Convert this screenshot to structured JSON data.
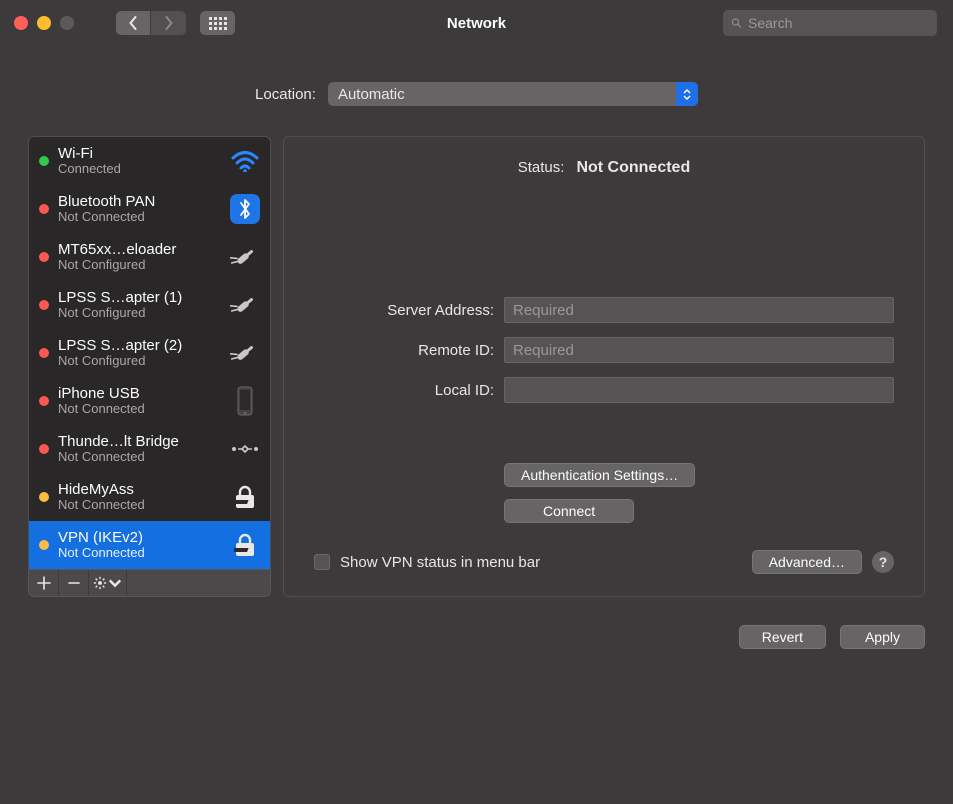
{
  "window": {
    "title": "Network",
    "search_placeholder": "Search"
  },
  "location": {
    "label": "Location:",
    "value": "Automatic"
  },
  "services": [
    {
      "name": "Wi-Fi",
      "status": "Connected",
      "dot": "green",
      "icon": "wifi",
      "selected": false
    },
    {
      "name": "Bluetooth PAN",
      "status": "Not Connected",
      "dot": "red",
      "icon": "bluetooth",
      "selected": false
    },
    {
      "name": "MT65xx…eloader",
      "status": "Not Configured",
      "dot": "red",
      "icon": "modem",
      "selected": false
    },
    {
      "name": "LPSS S…apter (1)",
      "status": "Not Configured",
      "dot": "red",
      "icon": "modem",
      "selected": false
    },
    {
      "name": "LPSS S…apter (2)",
      "status": "Not Configured",
      "dot": "red",
      "icon": "modem",
      "selected": false
    },
    {
      "name": "iPhone USB",
      "status": "Not Connected",
      "dot": "red",
      "icon": "iphone",
      "selected": false
    },
    {
      "name": "Thunde…lt Bridge",
      "status": "Not Connected",
      "dot": "red",
      "icon": "bridge",
      "selected": false
    },
    {
      "name": "HideMyAss",
      "status": "Not Connected",
      "dot": "yellow",
      "icon": "vpn",
      "selected": false
    },
    {
      "name": "VPN (IKEv2)",
      "status": "Not Connected",
      "dot": "yellow",
      "icon": "vpn",
      "selected": true
    }
  ],
  "detail": {
    "status_label": "Status:",
    "status_value": "Not Connected",
    "server_label": "Server Address:",
    "server_placeholder": "Required",
    "remote_label": "Remote ID:",
    "remote_placeholder": "Required",
    "local_label": "Local ID:",
    "auth_btn": "Authentication Settings…",
    "connect_btn": "Connect",
    "show_vpn_label": "Show VPN status in menu bar",
    "advanced_btn": "Advanced…",
    "help": "?"
  },
  "footer": {
    "revert": "Revert",
    "apply": "Apply"
  }
}
